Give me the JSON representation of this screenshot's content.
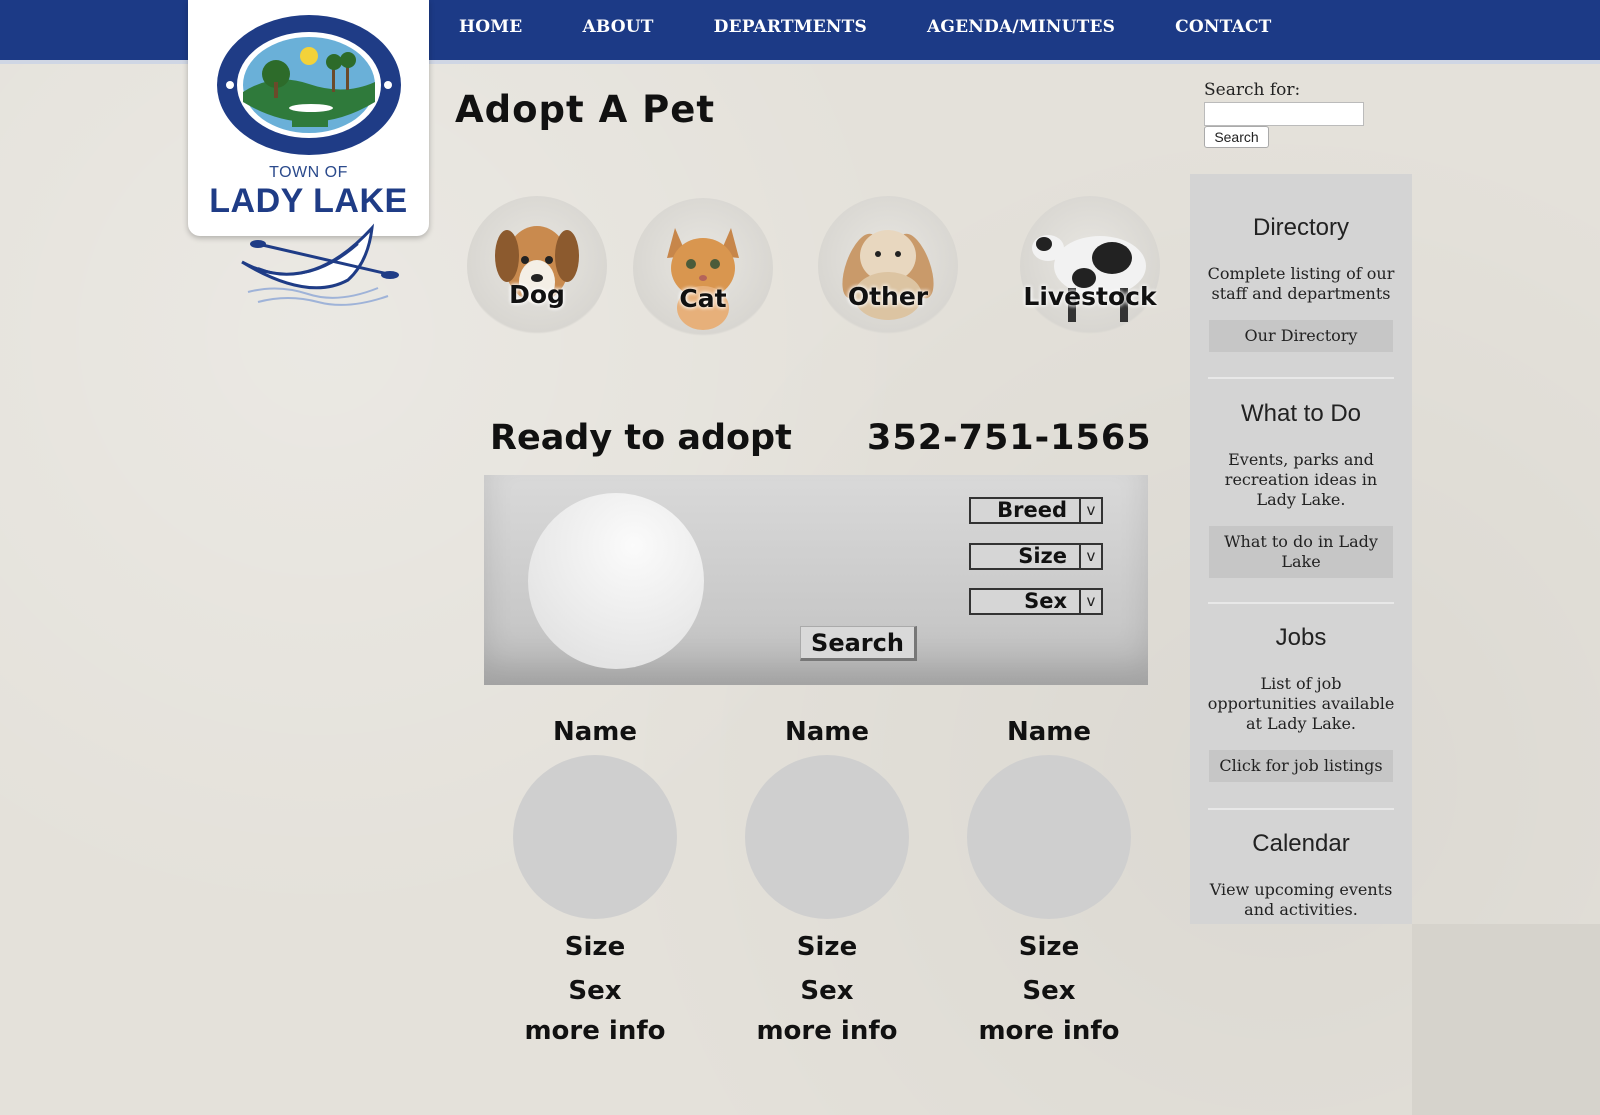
{
  "nav": {
    "items": [
      "HOME",
      "ABOUT",
      "DEPARTMENTS",
      "AGENDA/MINUTES",
      "CONTACT"
    ]
  },
  "logo": {
    "seal_text": "TOWN OF LADY LAKE",
    "small": "TOWN OF",
    "big": "LADY LAKE"
  },
  "page": {
    "title": "Adopt A Pet"
  },
  "search": {
    "label": "Search for:",
    "value": "",
    "button": "Search"
  },
  "categories": [
    {
      "label": "Dog",
      "icon": "dog-icon"
    },
    {
      "label": "Cat",
      "icon": "cat-icon"
    },
    {
      "label": "Other",
      "icon": "rabbit-icon"
    },
    {
      "label": "Livestock",
      "icon": "cow-icon"
    }
  ],
  "adopt": {
    "ready_text": "Ready to adopt",
    "phone": "352-751-1565"
  },
  "filters": {
    "dropdowns": [
      "Breed",
      "Size",
      "Sex"
    ],
    "arrow": "v",
    "search_button": "Search"
  },
  "pets": [
    {
      "name": "Name",
      "size": "Size",
      "sex": "Sex",
      "more": "more info"
    },
    {
      "name": "Name",
      "size": "Size",
      "sex": "Sex",
      "more": "more info"
    },
    {
      "name": "Name",
      "size": "Size",
      "sex": "Sex",
      "more": "more info"
    }
  ],
  "sidebar": {
    "sections": [
      {
        "title": "Directory",
        "desc": "Complete listing of our staff and departments",
        "button": "Our Directory"
      },
      {
        "title": "What to Do",
        "desc": "Events, parks and recreation ideas in Lady Lake.",
        "button": "What to do in Lady Lake"
      },
      {
        "title": "Jobs",
        "desc": "List of job opportunities available at Lady Lake.",
        "button": "Click for job listings"
      },
      {
        "title": "Calendar",
        "desc": "View upcoming events and activities.",
        "button": ""
      }
    ]
  },
  "colors": {
    "nav_bg": "#1c3a86",
    "page_bg": "#e4e1da",
    "sidebar_bg": "#d4d4d4",
    "panel_bg": "#d0d0d0"
  }
}
